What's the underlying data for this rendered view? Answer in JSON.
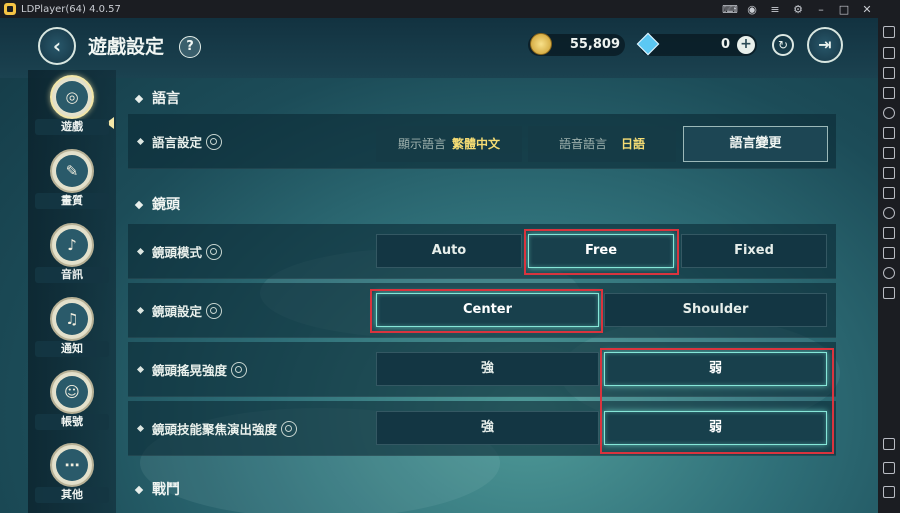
{
  "emulator": {
    "title": "LDPlayer(64) 4.0.57",
    "title_icons": [
      "gamepad-icon",
      "user-icon",
      "menu-icon",
      "settings-icon",
      "minimize-icon",
      "maximize-icon",
      "close-icon"
    ],
    "toolbar_icons": [
      "keyboard-icon",
      "volume-up-icon",
      "volume-down-icon",
      "screenshot-icon",
      "rotate-icon",
      "video-icon",
      "operation-record-icon",
      "scissors-icon",
      "play-icon",
      "sync-icon",
      "folder-icon",
      "location-icon",
      "shake-icon",
      "back-icon",
      "home-icon",
      "recent-apps-icon"
    ]
  },
  "header": {
    "title": "遊戲設定",
    "help": "?",
    "gold": "55,809",
    "gems": "0",
    "plus": "+"
  },
  "sidebar": {
    "tabs": [
      {
        "label": "遊戲",
        "icon": "gamepad-icon",
        "active": true
      },
      {
        "label": "畫質",
        "icon": "palette-icon",
        "active": false
      },
      {
        "label": "音訊",
        "icon": "speaker-icon",
        "active": false
      },
      {
        "label": "通知",
        "icon": "bell-icon",
        "active": false
      },
      {
        "label": "帳號",
        "icon": "account-icon",
        "active": false
      },
      {
        "label": "其他",
        "icon": "more-icon",
        "active": false
      }
    ]
  },
  "sections": {
    "language": {
      "title": "語言",
      "row_label": "語言設定",
      "display_lang_label": "顯示語言",
      "display_lang_value": "繁體中文",
      "voice_lang_label": "語音語言",
      "voice_lang_value": "日語",
      "change_button": "語言變更"
    },
    "camera": {
      "title": "鏡頭",
      "mode_label": "鏡頭模式",
      "mode_options": [
        "Auto",
        "Free",
        "Fixed"
      ],
      "mode_selected": "Free",
      "setting_label": "鏡頭設定",
      "setting_options": [
        "Center",
        "Shoulder"
      ],
      "setting_selected": "Center",
      "shake_label": "鏡頭搖晃強度",
      "shake_options": [
        "強",
        "弱"
      ],
      "shake_selected": "弱",
      "focus_label": "鏡頭技能聚焦演出強度",
      "focus_options": [
        "強",
        "弱"
      ],
      "focus_selected": "弱"
    },
    "battle": {
      "title": "戰鬥"
    }
  },
  "colors": {
    "accent_glow": "#86e6d8",
    "highlight_box": "#d9343e",
    "value_yellow": "#f5dc74"
  }
}
